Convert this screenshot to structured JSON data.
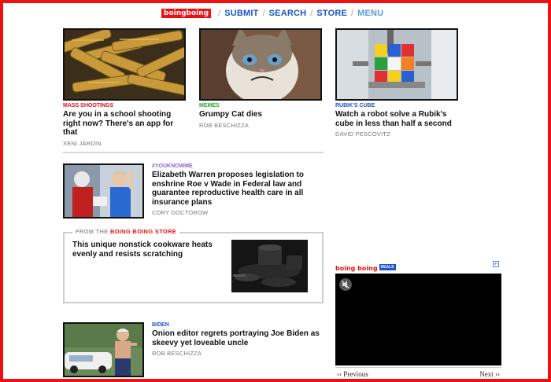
{
  "nav": {
    "logo": "boingboing",
    "links": [
      "SUBMIT",
      "SEARCH",
      "STORE",
      "MENU"
    ]
  },
  "colors": {
    "brand_red": "#ee1111",
    "link_blue": "#1a55c8"
  },
  "top_posts": [
    {
      "category": "MASS SHOOTINGS",
      "category_color": "#e01010",
      "title": "Are you in a school shooting right now? There's an app for that",
      "author": "XENI JARDIN"
    },
    {
      "category": "MEMES",
      "category_color": "#22aa22",
      "title": "Grumpy Cat dies",
      "author": "ROB BESCHIZZA"
    },
    {
      "category": "RUBIK'S CUBE",
      "category_color": "#1a55c8",
      "title": "Watch a robot solve a Rubik's cube in less than half a second",
      "author": "DAVID PESCOVITZ"
    }
  ],
  "list_posts": [
    {
      "category": "#YOUKNOWME",
      "category_color": "#8a66cc",
      "title": "Elizabeth Warren proposes legislation to enshrine Roe v Wade in Federal law and guarantee reproductive health care in all insurance plans",
      "author": "CORY DOCTOROW"
    },
    {
      "category": "BIDEN",
      "category_color": "#1a55c8",
      "title": "Onion editor regrets portraying Joe Biden as skeevy yet loveable uncle",
      "author": "ROB BESCHIZZA"
    }
  ],
  "store": {
    "label_prefix": "FROM THE",
    "label_store": "BOING BOING STORE",
    "title": "This unique nonstick cookware heats evenly and resists scratching"
  },
  "ad": {
    "logo": "boing boing",
    "badge": "DEALS",
    "prev": "‹‹ Previous",
    "next": "Next ››"
  }
}
